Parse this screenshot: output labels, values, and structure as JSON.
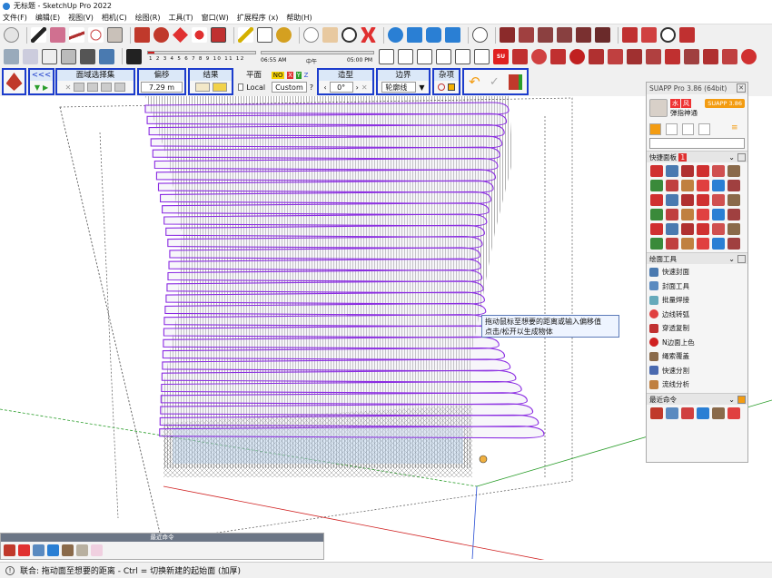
{
  "window": {
    "title": "无标题 - SketchUp Pro 2022"
  },
  "menu": [
    "文件(F)",
    "编辑(E)",
    "视图(V)",
    "相机(C)",
    "绘图(R)",
    "工具(T)",
    "窗口(W)",
    "扩展程序 (x)",
    "帮助(H)"
  ],
  "shadow": {
    "month_numbers": "1 2 3 4 5 6 7 8 9 10 11 12",
    "time_start": "06:55 AM",
    "time_mid": "中午",
    "time_end": "05:00 PM"
  },
  "offset_panel": {
    "nav_back": "<<<",
    "group_faces": "面域选择集",
    "group_offset": "偏移",
    "offset_value": "7.29 m",
    "group_result": "结果",
    "group_plane": "平面",
    "plane_no": "NO",
    "plane_x": "X",
    "plane_y": "Y",
    "plane_z": "Z",
    "plane_local": "Local",
    "plane_custom": "Custom",
    "plane_help": "?",
    "group_shape": "造型",
    "shape_angle": "0°",
    "group_boundary": "边界",
    "boundary_value": "轮廓线",
    "group_misc": "杂项"
  },
  "tooltip": {
    "line1": "拖动鼠标至想要的距离或输入偏移值",
    "line2": "点击/松开以生成物体"
  },
  "suapp": {
    "title": "SUAPP Pro 3.86 (64bit)",
    "user_tag1": "水",
    "user_tag2": "风",
    "user_name": "弹指神通",
    "badge": "SUAPP 3.86",
    "section_quick": "快捷面板",
    "section_quick_num": "1",
    "section_draw": "绘面工具",
    "tools": [
      "快速封面",
      "封面工具",
      "批量焊接",
      "边线转弧",
      "穿透复制",
      "N边面上色",
      "绳索覆盖",
      "快速分割",
      "流线分析"
    ],
    "section_recent": "最近命令"
  },
  "recent": {
    "title": "最近命令"
  },
  "status": {
    "text": "联合: 拖动面至想要的距离 - Ctrl = 切换新建的起始面 (加厚)"
  },
  "colors": {
    "accent_blue": "#1c3ccc",
    "slab_outline": "#8a2be2",
    "axis_red": "#d02020",
    "axis_green": "#2a9d2a",
    "axis_blue": "#2a4fd4"
  }
}
